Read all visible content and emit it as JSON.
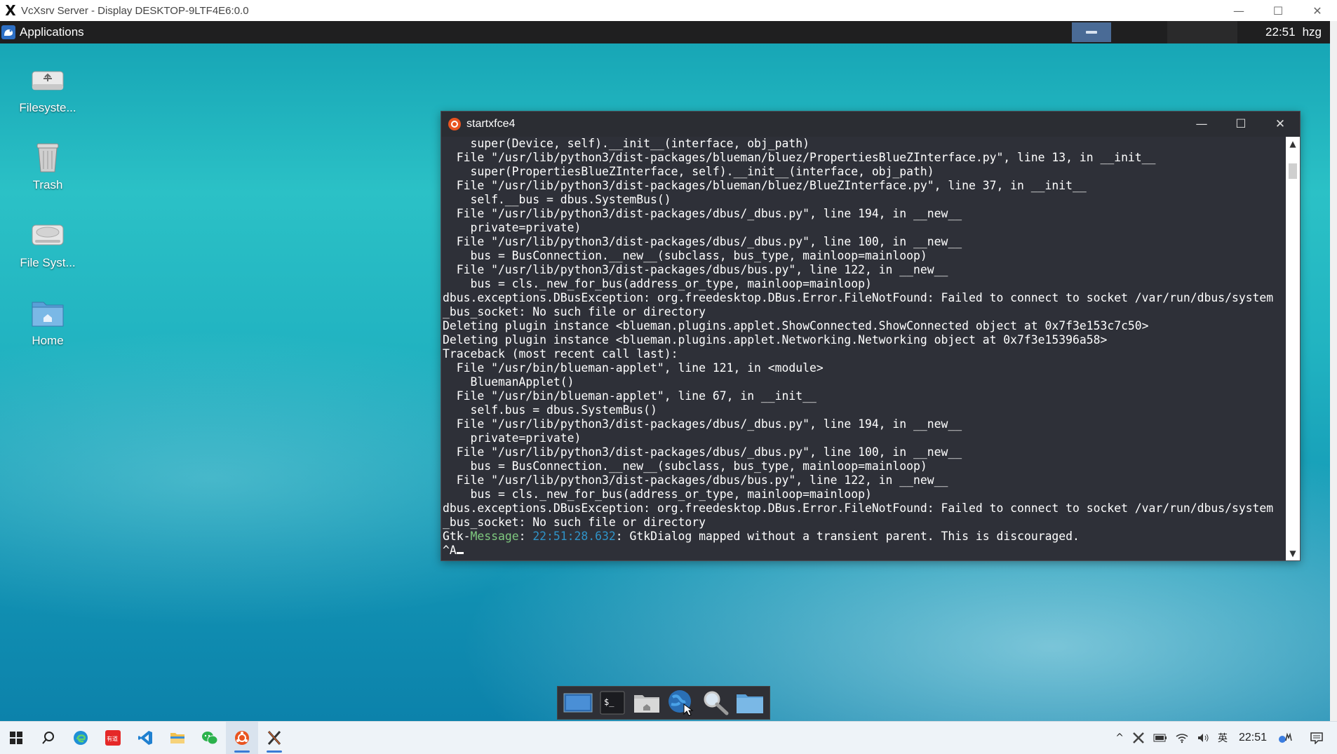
{
  "host_window": {
    "title": "VcXsrv Server - Display DESKTOP-9LTF4E6:0.0",
    "logo_glyph": "X",
    "minimize_glyph": "—",
    "maximize_glyph": "☐",
    "close_glyph": "✕"
  },
  "xfce_panel": {
    "applications_label": "Applications",
    "clock": "22:51",
    "user": "hzg"
  },
  "desktop_icons": [
    {
      "label": "Filesyste...",
      "icon": "usb-drive-icon"
    },
    {
      "label": "Trash",
      "icon": "trash-icon"
    },
    {
      "label": "File Syst...",
      "icon": "hard-drive-icon"
    },
    {
      "label": "Home",
      "icon": "home-folder-icon"
    }
  ],
  "terminal": {
    "title": "startxfce4",
    "minimize_glyph": "—",
    "maximize_glyph": "☐",
    "close_glyph": "✕",
    "lines": [
      "    super(Device, self).__init__(interface, obj_path)",
      "  File \"/usr/lib/python3/dist-packages/blueman/bluez/PropertiesBlueZInterface.py\", line 13, in __init__",
      "    super(PropertiesBlueZInterface, self).__init__(interface, obj_path)",
      "  File \"/usr/lib/python3/dist-packages/blueman/bluez/BlueZInterface.py\", line 37, in __init__",
      "    self.__bus = dbus.SystemBus()",
      "  File \"/usr/lib/python3/dist-packages/dbus/_dbus.py\", line 194, in __new__",
      "    private=private)",
      "  File \"/usr/lib/python3/dist-packages/dbus/_dbus.py\", line 100, in __new__",
      "    bus = BusConnection.__new__(subclass, bus_type, mainloop=mainloop)",
      "  File \"/usr/lib/python3/dist-packages/dbus/bus.py\", line 122, in __new__",
      "    bus = cls._new_for_bus(address_or_type, mainloop=mainloop)",
      "dbus.exceptions.DBusException: org.freedesktop.DBus.Error.FileNotFound: Failed to connect to socket /var/run/dbus/system",
      "_bus_socket: No such file or directory",
      "Deleting plugin instance <blueman.plugins.applet.ShowConnected.ShowConnected object at 0x7f3e153c7c50>",
      "Deleting plugin instance <blueman.plugins.applet.Networking.Networking object at 0x7f3e15396a58>",
      "Traceback (most recent call last):",
      "  File \"/usr/bin/blueman-applet\", line 121, in <module>",
      "    BluemanApplet()",
      "  File \"/usr/bin/blueman-applet\", line 67, in __init__",
      "    self.bus = dbus.SystemBus()",
      "  File \"/usr/lib/python3/dist-packages/dbus/_dbus.py\", line 194, in __new__",
      "    private=private)",
      "  File \"/usr/lib/python3/dist-packages/dbus/_dbus.py\", line 100, in __new__",
      "    bus = BusConnection.__new__(subclass, bus_type, mainloop=mainloop)",
      "  File \"/usr/lib/python3/dist-packages/dbus/bus.py\", line 122, in __new__",
      "    bus = cls._new_for_bus(address_or_type, mainloop=mainloop)",
      "dbus.exceptions.DBusException: org.freedesktop.DBus.Error.FileNotFound: Failed to connect to socket /var/run/dbus/system",
      "_bus_socket: No such file or directory"
    ],
    "gtk_message": {
      "prefix": "Gtk-",
      "tag": "Message",
      "sep1": ": ",
      "time": "22:51:28.632",
      "sep2": ": ",
      "text": "GtkDialog mapped without a transient parent. This is discouraged."
    },
    "prompt_text": "^A",
    "colors": {
      "background": "#2e3038",
      "text": "#ffffff",
      "green": "#7fc97f",
      "blue": "#2f93c8"
    }
  },
  "dock_items": [
    {
      "icon": "show-desktop-icon"
    },
    {
      "icon": "terminal-icon",
      "glyph": "$_"
    },
    {
      "icon": "home-files-icon"
    },
    {
      "icon": "web-browser-icon"
    },
    {
      "icon": "app-finder-icon"
    },
    {
      "icon": "folder-icon"
    }
  ],
  "win_taskbar": {
    "items": [
      {
        "icon": "windows-start-icon"
      },
      {
        "icon": "search-icon"
      },
      {
        "icon": "edge-browser-icon"
      },
      {
        "icon": "youdao-dict-icon",
        "glyph": "有道"
      },
      {
        "icon": "vscode-icon"
      },
      {
        "icon": "file-explorer-icon"
      },
      {
        "icon": "wechat-icon"
      },
      {
        "icon": "ubuntu-icon"
      },
      {
        "icon": "vcxsrv-icon"
      }
    ],
    "tray": {
      "chevron_glyph": "^",
      "ime": "英",
      "clock": "22:51",
      "notification_icon": "notification-icon"
    }
  }
}
